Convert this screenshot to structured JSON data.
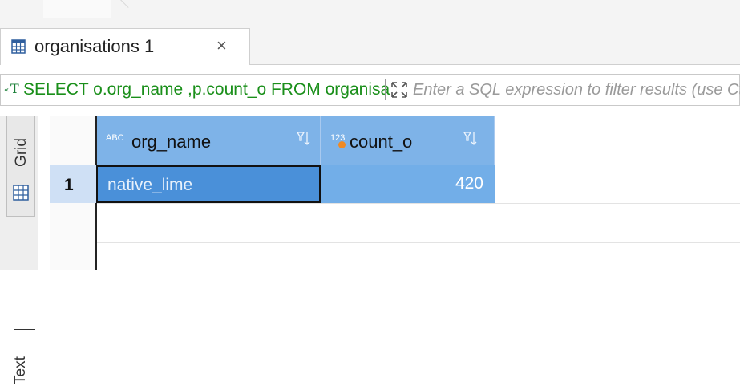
{
  "tab": {
    "title": "organisations 1",
    "close_glyph": "×",
    "icon": "table-icon"
  },
  "query": {
    "sql_icon": "sql-text-icon",
    "sql_text": "SELECT o.org_name ,p.count_o FROM organisa",
    "filter_placeholder": "Enter a SQL expression to filter results (use Ctrl+Space)"
  },
  "side_tabs": {
    "grid_label": "Grid",
    "text_label": "Text"
  },
  "grid": {
    "columns": [
      {
        "type_badge": "ABC",
        "name": "org_name"
      },
      {
        "type_badge": "123",
        "name": "count_o"
      }
    ],
    "rows": [
      {
        "num": "1",
        "org_name": "native_lime",
        "count_o": "420"
      }
    ]
  },
  "colors": {
    "header_bg": "#7eb3e8",
    "selected_cell": "#4a90d9",
    "sql_green": "#1a8f1a",
    "orange_dot": "#f08a24"
  }
}
